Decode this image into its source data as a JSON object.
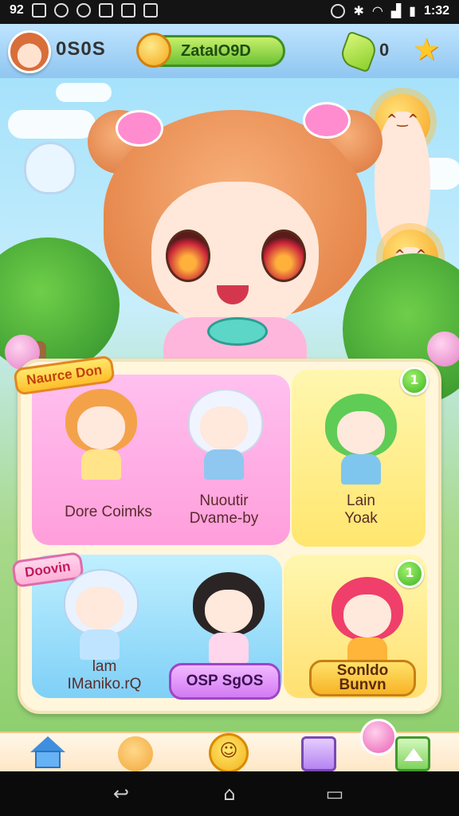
{
  "status_bar": {
    "left_text": "92",
    "time": "1:32",
    "icons": [
      "image-icon",
      "circle-icon",
      "app-icon",
      "game-icon",
      "photo-icon",
      "flag-icon",
      "alarm-icon",
      "bluetooth-icon",
      "wifi-icon",
      "signal-icon",
      "battery-icon"
    ]
  },
  "top_bar": {
    "coins": "0S0S",
    "energy_label": "ZataIO9D",
    "gem_count": "0"
  },
  "panel": {
    "tag_top": "Naurce Don",
    "tag_bottom": "Doovin",
    "badge_top": "1",
    "badge_bottom": "1",
    "characters": [
      {
        "name_line1": "Dore Coimks",
        "name_line2": ""
      },
      {
        "name_line1": "Nuoutir",
        "name_line2": "Dvame-by"
      },
      {
        "name_line1": "Lain",
        "name_line2": "Yoak"
      },
      {
        "name_line1": "lam",
        "name_line2": "IManiko.rQ"
      }
    ],
    "button_center": "OSP SgOS",
    "button_right_line1": "Sonldo",
    "button_right_line2": "Bunvn"
  },
  "colors": {
    "accent_pink": "#ff9edb",
    "accent_yellow": "#ffe66e",
    "accent_blue": "#7fd0f7",
    "accent_green": "#6cc234"
  }
}
